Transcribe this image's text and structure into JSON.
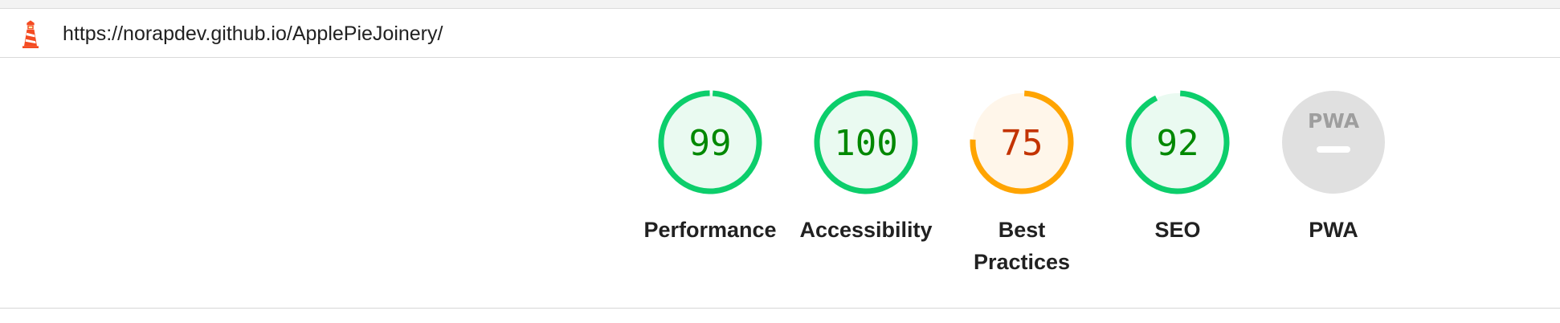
{
  "url_bar": {
    "icon": "lighthouse-icon",
    "url": "https://norapdev.github.io/ApplePieJoinery/"
  },
  "colors": {
    "pass": "#0cce6b",
    "pass_bg": "#eafaf1",
    "pass_text": "#008800",
    "average": "#ffa400",
    "average_bg": "#fff6ea",
    "average_text": "#c33300",
    "pwa_bg": "#e0e0e0",
    "pwa_fg": "#9e9e9e",
    "lighthouse": "#f44b21"
  },
  "gauges": [
    {
      "label": "Performance",
      "score": "99",
      "value": 99,
      "rating": "pass"
    },
    {
      "label": "Accessibility",
      "score": "100",
      "value": 100,
      "rating": "pass"
    },
    {
      "label": "Best Practices",
      "score": "75",
      "value": 75,
      "rating": "average"
    },
    {
      "label": "SEO",
      "score": "92",
      "value": 92,
      "rating": "pass"
    },
    {
      "label": "PWA",
      "badge_text": "PWA",
      "rating": "pwa"
    }
  ]
}
